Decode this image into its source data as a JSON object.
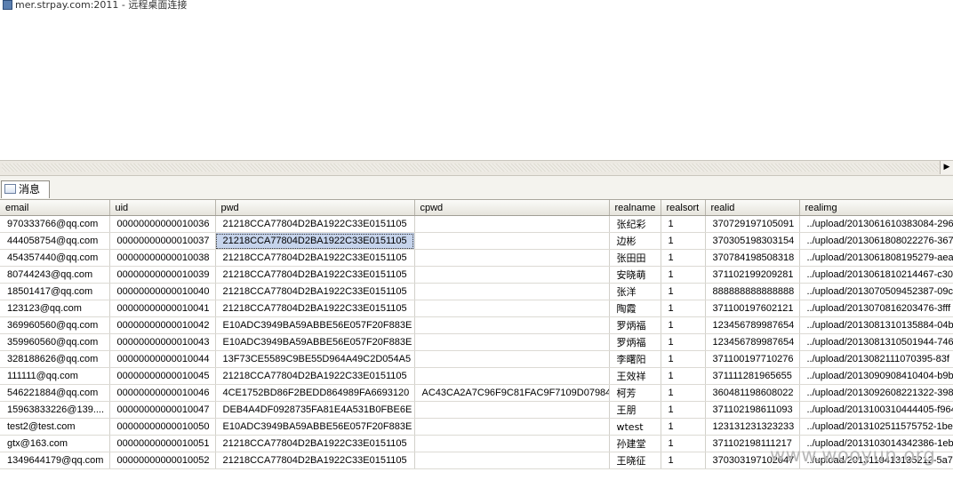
{
  "window": {
    "title": "mer.strpay.com:2011 - 远程桌面连接"
  },
  "tab": {
    "label": "消息"
  },
  "grid": {
    "columns": [
      "email",
      "uid",
      "pwd",
      "cpwd",
      "realname",
      "realsort",
      "realid",
      "realimg"
    ],
    "rows": [
      [
        "970333766@qq.com",
        "00000000000010036",
        "21218CCA77804D2BA1922C33E0151105",
        "",
        "张纪彩",
        "1",
        "370729197105091",
        "../upload/20130616103830​84-296"
      ],
      [
        "444058754@qq.com",
        "00000000000010037",
        "21218CCA77804D2BA1922C33E0151105",
        "",
        "边彬",
        "1",
        "370305198303154",
        "../upload/20130618080222​76-367"
      ],
      [
        "454357440@qq.com",
        "00000000000010038",
        "21218CCA77804D2BA1922C33E0151105",
        "",
        "张田田",
        "1",
        "370784198508318",
        "../upload/20130618081952​79-aea"
      ],
      [
        "80744243@qq.com",
        "00000000000010039",
        "21218CCA77804D2BA1922C33E0151105",
        "",
        "安晓萌",
        "1",
        "371102199209281",
        "../upload/20130618102144​67-c30"
      ],
      [
        "18501417@qq.com",
        "00000000000010040",
        "21218CCA77804D2BA1922C33E0151105",
        "",
        "张洋",
        "1",
        "888888888888888",
        "../upload/20130705094523​87-09c"
      ],
      [
        "123123@qq.com",
        "00000000000010041",
        "21218CCA77804D2BA1922C33E0151105",
        "",
        "陶霞",
        "1",
        "371100197602121",
        "../upload/20130708162034​76-3fff"
      ],
      [
        "369960560@qq.com",
        "00000000000010042",
        "E10ADC3949BA59ABBE56E057F20F883E",
        "",
        "罗炳福",
        "1",
        "123456789987654",
        "../upload/20130813101358​84-04b"
      ],
      [
        "359960560@qq.com",
        "00000000000010043",
        "E10ADC3949BA59ABBE56E057F20F883E",
        "",
        "罗炳福",
        "1",
        "123456789987654",
        "../upload/20130813105019​44-746"
      ],
      [
        "328188626@qq.com",
        "00000000000010044",
        "13F73CE5589C9BE55D964A49C2D054A5",
        "",
        "李曙阳",
        "1",
        "371100197710276",
        "../upload/20130821110703​95-83f"
      ],
      [
        "111111@qq.com",
        "00000000000010045",
        "21218CCA77804D2BA1922C33E0151105",
        "",
        "王效祥",
        "1",
        "371111281965655",
        "../upload/20130909084104​04-b9b"
      ],
      [
        "546221884@qq.com",
        "00000000000010046",
        "4CE1752BD86F2BEDD864989FA6693120",
        "AC43CA2A7C96F9C81FAC9F7109D07984",
        "柯芳",
        "1",
        "360481198608022",
        "../upload/20130926082213​22-398"
      ],
      [
        "15963833226@139....",
        "00000000000010047",
        "DEB4A4DF0928735FA81E4A531B0FBE6E",
        "",
        "王朋",
        "1",
        "371102198611093",
        "../upload/20131003104444​05-f964"
      ],
      [
        "test2@test.com",
        "00000000000010050",
        "E10ADC3949BA59ABBE56E057F20F883E",
        "",
        "wtest",
        "1",
        "123131231323233",
        "../upload/20131025115757​52-1be"
      ],
      [
        "gtx@163.com",
        "00000000000010051",
        "21218CCA77804D2BA1922C33E0151105",
        "",
        "孙建堂",
        "1",
        "371102198111217",
        "../upload/20131030143423​86-1eb"
      ],
      [
        "1349644179@qq.com",
        "00000000000010052",
        "21218CCA77804D2BA1922C33E0151105",
        "",
        "王晓征",
        "1",
        "370303197102047",
        "../upload/20131104131352​12-5a72"
      ]
    ]
  },
  "watermark": {
    "text": "www.wooyun.org"
  }
}
